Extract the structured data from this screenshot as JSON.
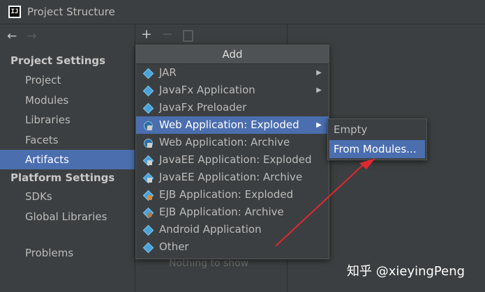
{
  "window": {
    "title": "Project Structure",
    "app_icon": "intellij-icon"
  },
  "sidebar": {
    "nav": {
      "back": "←",
      "forward": "→"
    },
    "sections": [
      {
        "title": "Project Settings",
        "items": [
          "Project",
          "Modules",
          "Libraries",
          "Facets",
          "Artifacts"
        ]
      },
      {
        "title": "Platform Settings",
        "items": [
          "SDKs",
          "Global Libraries"
        ]
      }
    ],
    "extra_items": [
      "Problems"
    ],
    "selected": "Artifacts"
  },
  "toolbar": {
    "add": "+",
    "remove": "−"
  },
  "artifacts_panel": {
    "empty_text": "Nothing to show"
  },
  "add_menu": {
    "header": "Add",
    "items": [
      {
        "label": "JAR",
        "icon": "jar-icon",
        "has_submenu": true
      },
      {
        "label": "JavaFx Application",
        "icon": "javafx-icon",
        "has_submenu": true
      },
      {
        "label": "JavaFx Preloader",
        "icon": "javafx-icon",
        "has_submenu": false
      },
      {
        "label": "Web Application: Exploded",
        "icon": "web-icon",
        "has_submenu": true,
        "selected": true
      },
      {
        "label": "Web Application: Archive",
        "icon": "web-icon",
        "has_submenu": false
      },
      {
        "label": "JavaEE Application: Exploded",
        "icon": "javaee-icon",
        "has_submenu": false
      },
      {
        "label": "JavaEE Application: Archive",
        "icon": "javaee-icon",
        "has_submenu": false
      },
      {
        "label": "EJB Application: Exploded",
        "icon": "ejb-icon",
        "has_submenu": false
      },
      {
        "label": "EJB Application: Archive",
        "icon": "ejb-icon",
        "has_submenu": false
      },
      {
        "label": "Android Application",
        "icon": "android-icon",
        "has_submenu": false
      },
      {
        "label": "Other",
        "icon": "other-icon",
        "has_submenu": false
      }
    ],
    "submenu_arrow": "▶"
  },
  "submenu": {
    "items": [
      {
        "label": "Empty",
        "selected": false
      },
      {
        "label": "From Modules...",
        "selected": true
      }
    ]
  },
  "watermark": "知乎 @xieyingPeng",
  "colors": {
    "accent": "#4b6eaf",
    "arrow": "#e0282f",
    "background": "#3c3f41"
  }
}
